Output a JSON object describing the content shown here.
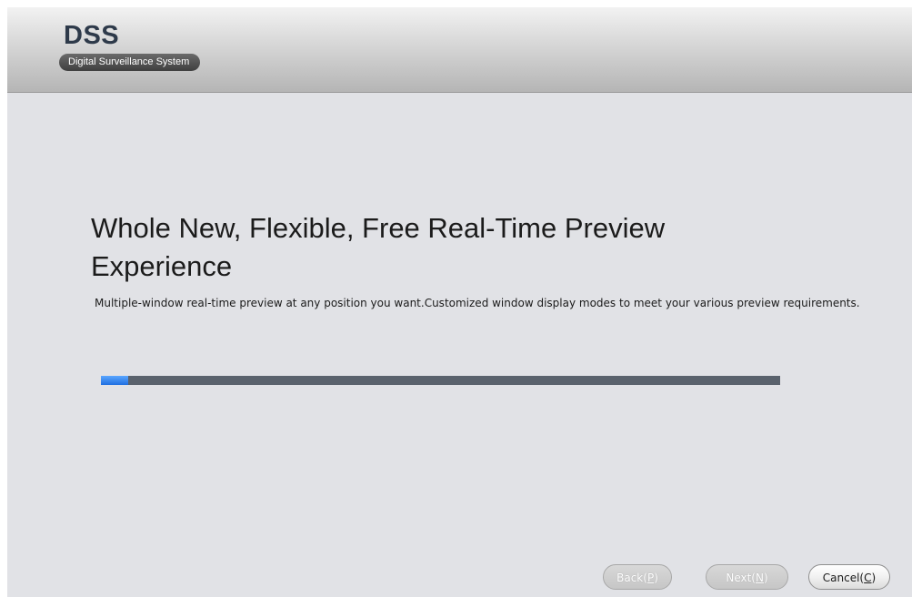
{
  "header": {
    "logo_title": "DSS",
    "logo_subtitle": "Digital Surveillance System"
  },
  "main": {
    "headline_line1": "Whole New, Flexible, Free Real-Time Preview",
    "headline_line2": "Experience",
    "description": "Multiple-window real-time preview at any position you want.Customized window display modes to meet your various preview requirements.",
    "progress": {
      "value_percent": 4
    }
  },
  "buttons": {
    "back": {
      "label": "Back(",
      "accel": "P",
      "close": ")",
      "enabled": false
    },
    "next": {
      "label": "Next(",
      "accel": "N",
      "close": ")",
      "enabled": false
    },
    "cancel": {
      "label": "Cancel(",
      "accel": "C",
      "close": ")",
      "enabled": true
    }
  },
  "colors": {
    "accent": "#1f6fe0",
    "background": "#e1e2e6",
    "progress_track": "#5a626d"
  }
}
